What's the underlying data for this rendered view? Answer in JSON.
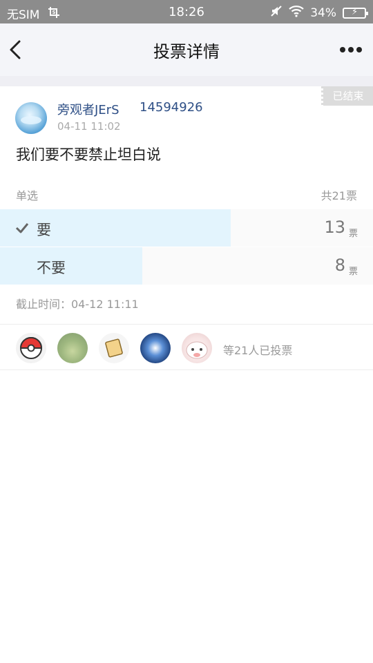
{
  "status_bar": {
    "carrier": "无SIM",
    "sim_icon": "screenshot-icon",
    "time": "18:26",
    "battery": "34%",
    "icons": [
      "mute-icon",
      "wifi-icon",
      "battery-charging-icon"
    ]
  },
  "nav": {
    "title": "投票详情",
    "back_icon": "chevron-left-icon",
    "more_icon": "more-dots-icon"
  },
  "post": {
    "status_badge": "已结束",
    "author": "旁观者JErS",
    "author_id": "14594926",
    "time": "04-11 11:02",
    "question": "我们要不要禁止坦白说"
  },
  "vote": {
    "type": "单选",
    "total": "共21票",
    "deadline": "截止时间：04-12 11:11",
    "options": [
      {
        "label": "要",
        "count": "13",
        "unit": "票",
        "selected": true,
        "fraction": 0.619
      },
      {
        "label": "不要",
        "count": "8",
        "unit": "票",
        "selected": false,
        "fraction": 0.381
      }
    ]
  },
  "voters": {
    "summary": "等21人已投票",
    "avatars": [
      "pokeball-avatar",
      "landscape-avatar",
      "sticker-avatar",
      "anime-character-avatar",
      "cat-avatar"
    ]
  },
  "colors": {
    "status_bar": "#8c8c8c",
    "nav_bg": "#f4f5f9",
    "link_blue": "#2e4f86",
    "vote_fill": "#e3f4fd",
    "badge_gray": "#dcdcdc"
  }
}
